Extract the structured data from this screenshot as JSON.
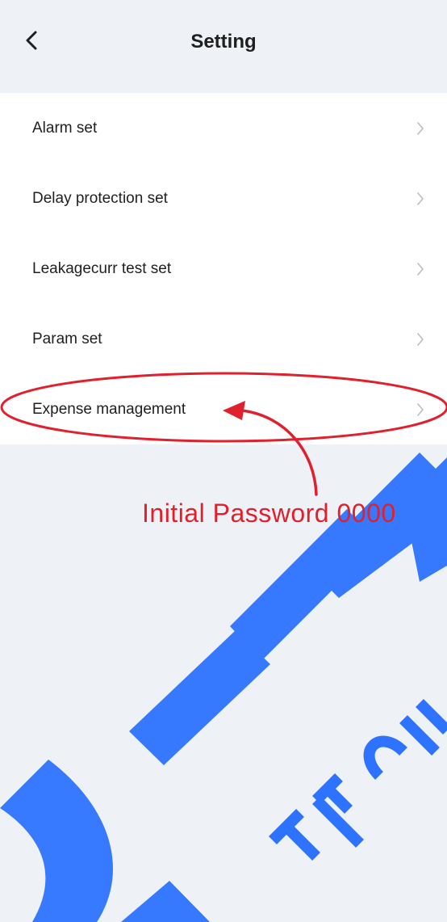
{
  "header": {
    "title": "Setting",
    "back_icon": "chevron-left-icon"
  },
  "settings": {
    "items": [
      {
        "label": "Alarm set"
      },
      {
        "label": "Delay protection set"
      },
      {
        "label": "Leakagecurr test set"
      },
      {
        "label": "Param set"
      },
      {
        "label": "Expense management"
      }
    ],
    "chevron_icon": "chevron-right-icon"
  },
  "annotation": {
    "text": "Initial Password  0000",
    "color": "#e0202c"
  },
  "watermark": {
    "text": "TRI TECHN",
    "color": "#1f6cff"
  }
}
